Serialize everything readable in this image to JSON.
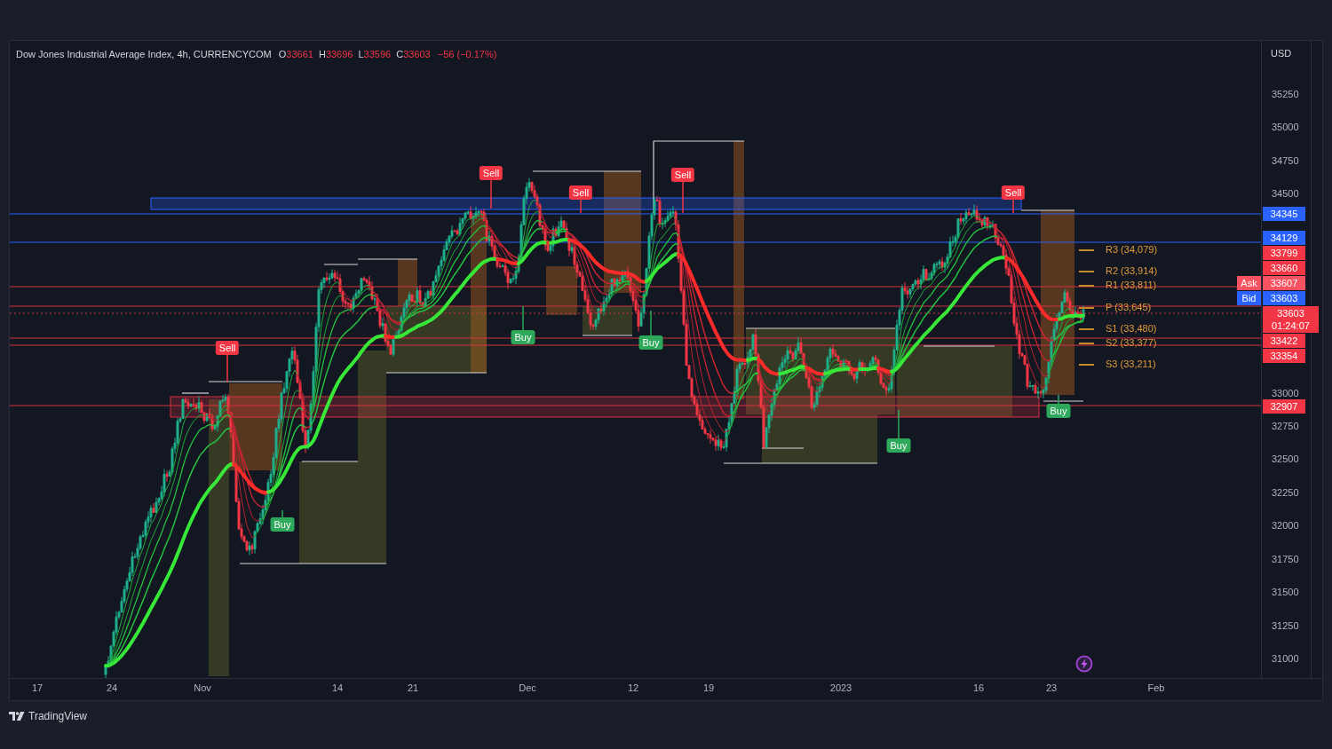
{
  "legend": {
    "title": "Dow Jones Industrial Average Index, 4h, CURRENCYCOM",
    "ohlc": [
      {
        "label": "O",
        "value": "33661"
      },
      {
        "label": "H",
        "value": "33696"
      },
      {
        "label": "L",
        "value": "33596"
      },
      {
        "label": "C",
        "value": "33603"
      }
    ],
    "change": "−56 (−0.17%)"
  },
  "price_axis": {
    "currency": "USD",
    "ticks": [
      "35250",
      "35000",
      "34750",
      "34500",
      "33000",
      "32750",
      "32500",
      "32250",
      "32000",
      "31750",
      "31500",
      "31250",
      "31000"
    ]
  },
  "price_tags": [
    {
      "text": "34345",
      "color": "#2962ff"
    },
    {
      "text": "34129",
      "color": "#2962ff"
    },
    {
      "text": "33799",
      "color": "#f23645"
    },
    {
      "text": "33660",
      "color": "#f23645"
    },
    {
      "text": "33607",
      "color": "#f7525f",
      "side_label": "Ask"
    },
    {
      "text": "33603",
      "color": "#2962ff",
      "side_label": "Bid"
    },
    {
      "text": "33603",
      "countdown": "01:24:07",
      "color": "#f23645"
    },
    {
      "text": "33422",
      "color": "#f23645"
    },
    {
      "text": "33354",
      "color": "#f23645"
    },
    {
      "text": "32907",
      "color": "#f23645"
    }
  ],
  "pivots": [
    "R3 (34,079)",
    "R2 (33,914)",
    "R1 (33,811)",
    "P (33,645)",
    "S1 (33,480)",
    "S2 (33,377)",
    "S3 (33,211)"
  ],
  "signals": [
    {
      "kind": "sell",
      "label": "Sell"
    },
    {
      "kind": "buy",
      "label": "Buy"
    },
    {
      "kind": "sell",
      "label": "Sell"
    },
    {
      "kind": "buy",
      "label": "Buy"
    },
    {
      "kind": "sell",
      "label": "Sell"
    },
    {
      "kind": "buy",
      "label": "Buy"
    },
    {
      "kind": "sell",
      "label": "Sell"
    },
    {
      "kind": "buy",
      "label": "Buy"
    },
    {
      "kind": "sell",
      "label": "Sell"
    },
    {
      "kind": "buy",
      "label": "Buy"
    }
  ],
  "time_axis": {
    "labels": [
      "17",
      "24",
      "Nov",
      "14",
      "21",
      "Dec",
      "12",
      "19",
      "2023",
      "16",
      "23",
      "Feb"
    ]
  },
  "footer": {
    "brand": "TradingView"
  }
}
